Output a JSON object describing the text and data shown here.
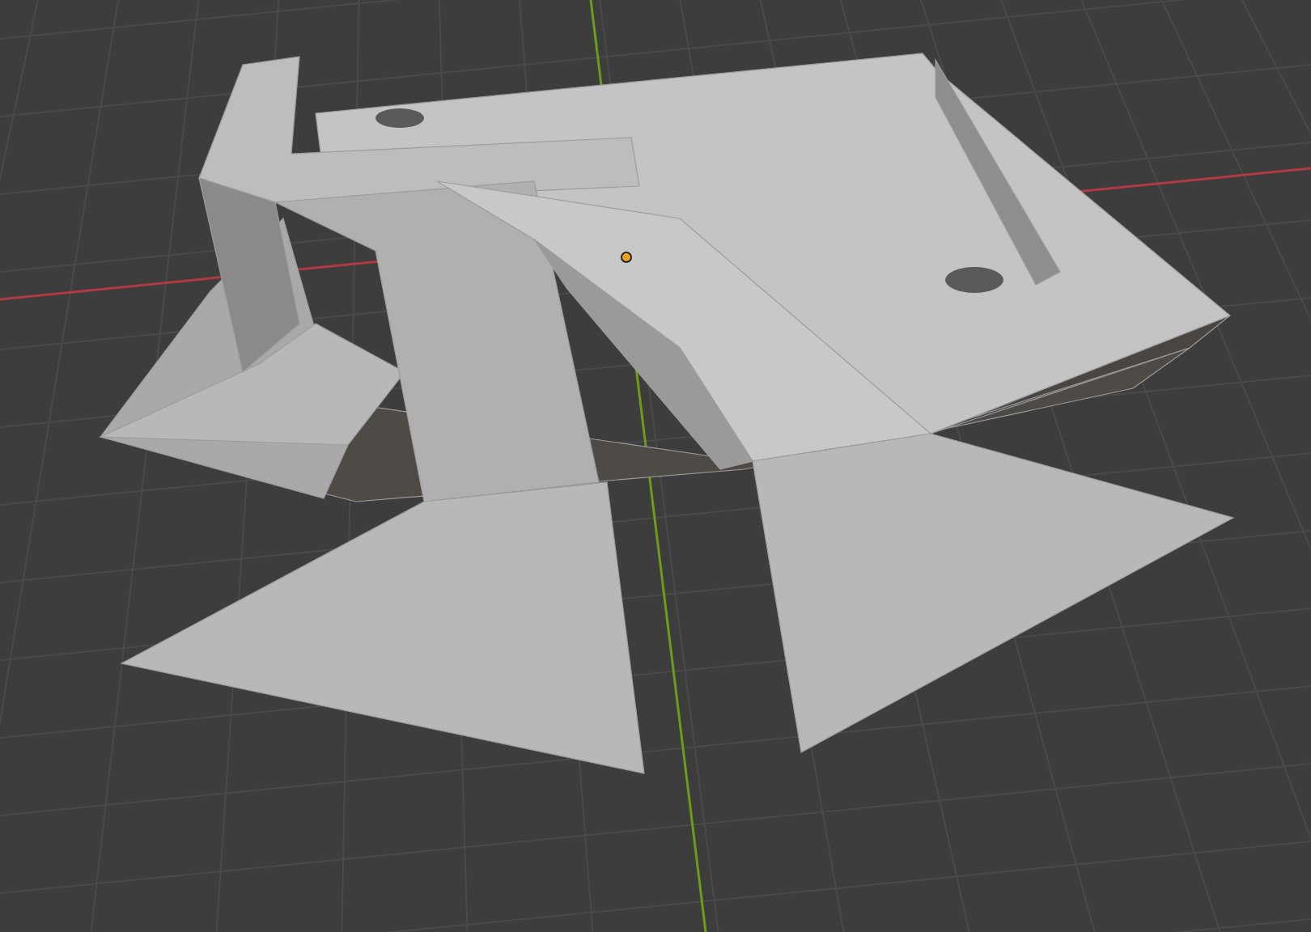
{
  "viewport": {
    "kind": "mesh",
    "origin_visible": true
  }
}
